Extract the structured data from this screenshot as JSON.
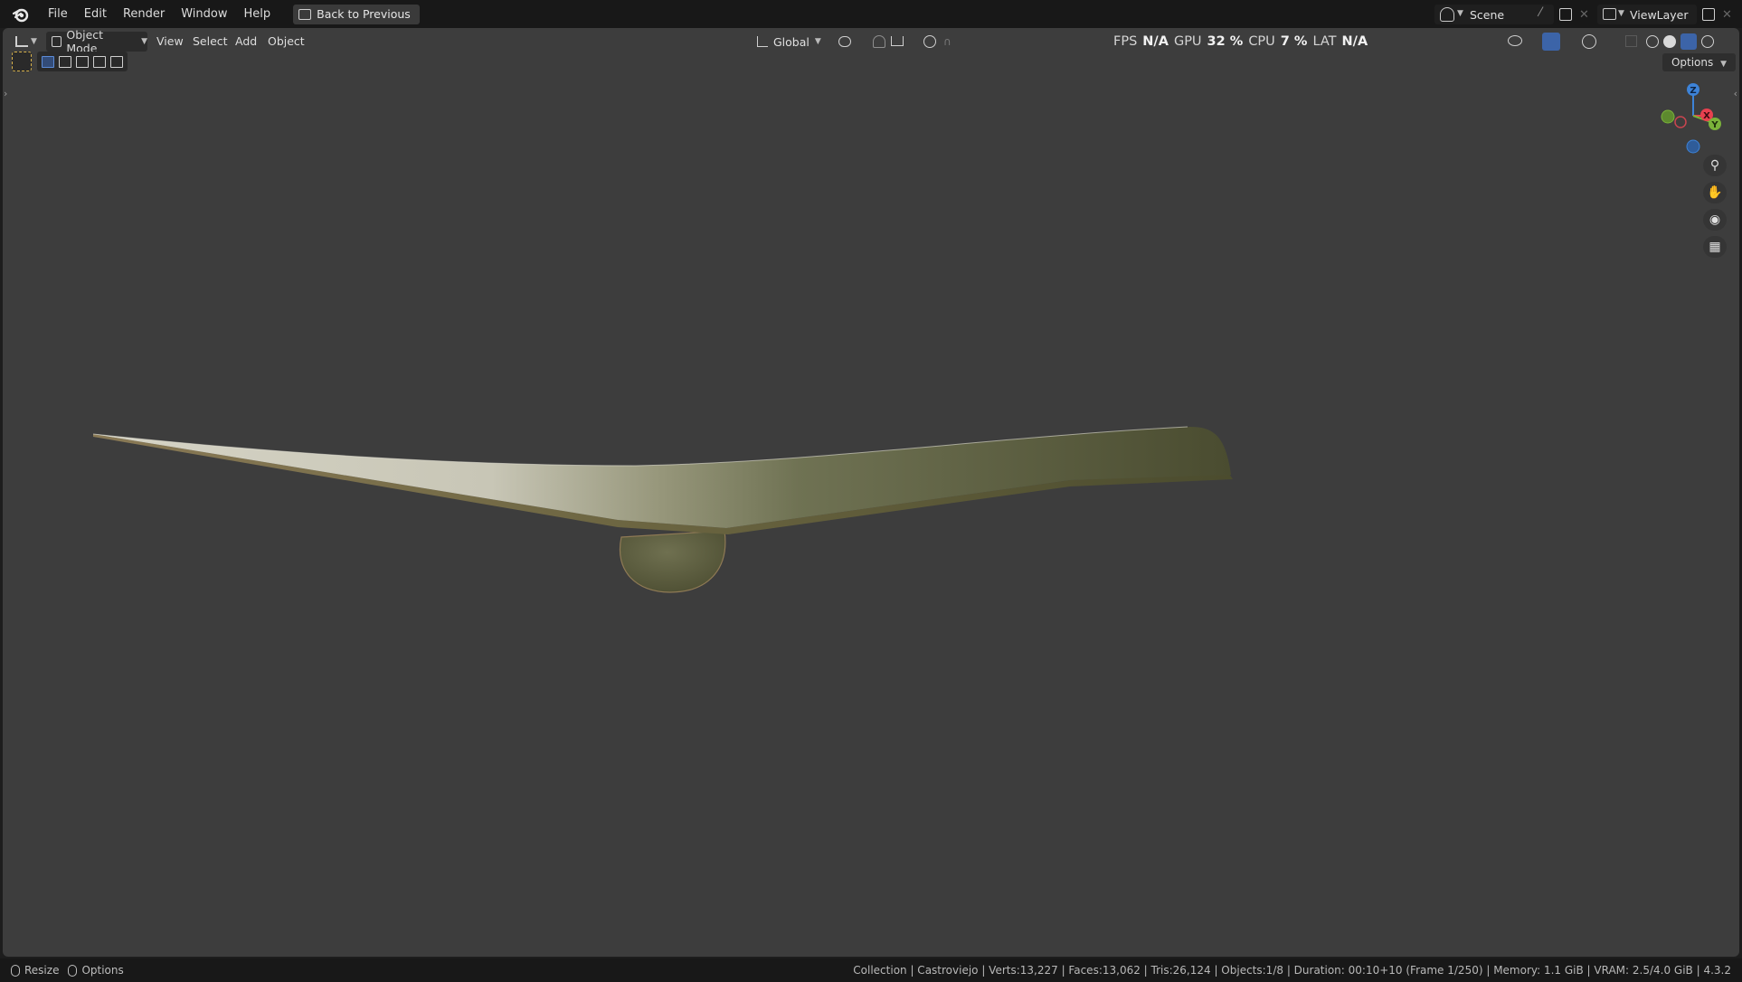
{
  "menubar": {
    "items": [
      "File",
      "Edit",
      "Render",
      "Window",
      "Help"
    ],
    "back_button": "Back to Previous",
    "scene": "Scene",
    "view_layer": "ViewLayer"
  },
  "viewport_header": {
    "mode": "Object Mode",
    "menus": [
      "View",
      "Select",
      "Add",
      "Object"
    ],
    "transform_orientation": "Global",
    "options": "Options"
  },
  "stats": {
    "fps_label": "FPS",
    "fps_value": "N/A",
    "gpu_label": "GPU",
    "gpu_value": "32 %",
    "cpu_label": "CPU",
    "cpu_value": "7 %",
    "lat_label": "LAT",
    "lat_value": "N/A"
  },
  "gizmo": {
    "z": "Z",
    "x": "X",
    "y": "Y"
  },
  "statusbar": {
    "resize": "Resize",
    "options": "Options",
    "info": "Collection | Castroviejo | Verts:13,227 | Faces:13,062 | Tris:26,124 | Objects:1/8 | Duration: 00:10+10 (Frame 1/250) | Memory: 1.1 GiB | VRAM: 2.5/4.0 GiB | 4.3.2"
  },
  "colors": {
    "viewport_bg": "#3d3d3d",
    "ui_bg": "#181818",
    "axis_x": "#e8404f",
    "axis_y": "#7ab33a",
    "axis_z": "#3d83d8"
  }
}
